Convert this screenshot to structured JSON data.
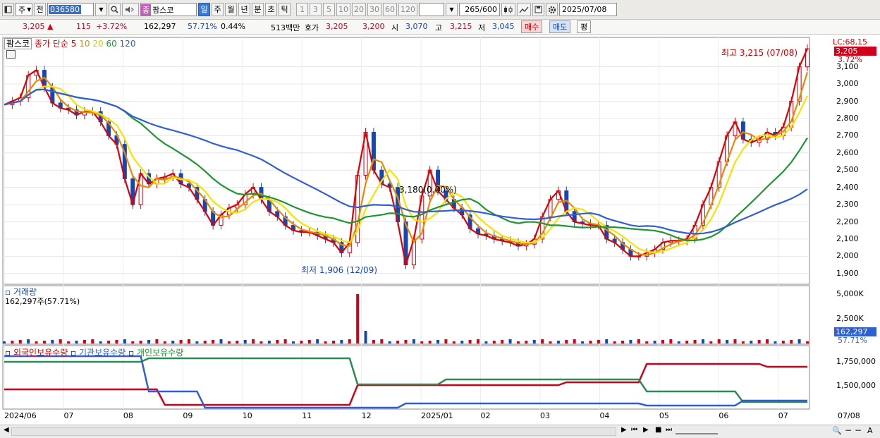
{
  "toolbar": {
    "market": "주",
    "prev_label": "전",
    "code": "036580",
    "name_icon": "종",
    "name": "팜스코",
    "periods": [
      "일",
      "주",
      "월",
      "년",
      "분",
      "초",
      "틱"
    ],
    "period_selected": "일",
    "counts": [
      "1",
      "3",
      "5",
      "10",
      "20",
      "30",
      "60",
      "120"
    ],
    "range": "265/600",
    "date": "2025/07/08"
  },
  "quote": {
    "price": "3,205 ▲",
    "change": "115",
    "rate": "+3.72%",
    "volume": "162,297",
    "vol_rate": "57.71%",
    "turnover": "0.44%",
    "amount": "513백만",
    "bid_label": "호가",
    "bid1": "3,205",
    "bid2": "3,200",
    "open_label": "시",
    "open": "3,070",
    "high_label": "고",
    "high": "3,215",
    "low_label": "저",
    "low": "3,045",
    "buy": "매수",
    "sell": "매도",
    "avg": "평"
  },
  "legend": {
    "stock_name": "팜스코",
    "ma_title": "종가 단순 5",
    "ma10": "10",
    "ma20": "20",
    "ma60": "60",
    "ma120": "120",
    "colors": {
      "ma5": "#e00000",
      "ma10": "#e88a00",
      "ma20": "#f5e300",
      "ma60": "#1e9632",
      "ma120": "#2f5fd0"
    }
  },
  "annotations": {
    "high": "최고 3,215 (07/08)",
    "low": "최저 1,906 (12/09)",
    "mid": "3,180(0.00%)"
  },
  "price_axis": {
    "lc": "LC:68,15",
    "last": "3,205",
    "rate": "3.72%",
    "ticks": [
      "3,100",
      "3,000",
      "2,900",
      "2,800",
      "2,700",
      "2,600",
      "2,500",
      "2,400",
      "2,300",
      "2,200",
      "2,100",
      "2,000",
      "1,900"
    ]
  },
  "volume_panel": {
    "title": "거래량",
    "value": "162,297주(57.71%)",
    "ticks": [
      "5,000K",
      "2,500K"
    ],
    "last": "162,297",
    "rate": "57.71%"
  },
  "holding_panel": {
    "l1": "외국인보유수량",
    "l2": "기관보유수량",
    "l3": "개인보유수량",
    "ticks": [
      "1,750,000",
      "1,500,000"
    ]
  },
  "x_axis": [
    "2024/06",
    "07",
    "08",
    "09",
    "10",
    "11",
    "12",
    "2025/01",
    "02",
    "03",
    "04",
    "05",
    "06",
    "07",
    "07/08"
  ],
  "chart_data": {
    "type": "line",
    "title": "팜스코 일봉",
    "y_range": [
      1850,
      3250
    ],
    "close": [
      2880,
      2900,
      2920,
      3050,
      3080,
      2980,
      2890,
      2860,
      2850,
      2820,
      2840,
      2840,
      2780,
      2700,
      2650,
      2450,
      2300,
      2480,
      2420,
      2450,
      2460,
      2480,
      2420,
      2400,
      2330,
      2260,
      2180,
      2240,
      2280,
      2300,
      2360,
      2400,
      2330,
      2260,
      2230,
      2180,
      2150,
      2140,
      2140,
      2120,
      2100,
      2080,
      2020,
      2080,
      2470,
      2720,
      2500,
      2420,
      2400,
      2200,
      1950,
      2100,
      2350,
      2500,
      2380,
      2330,
      2280,
      2240,
      2160,
      2130,
      2120,
      2100,
      2090,
      2080,
      2060,
      2070,
      2100,
      2230,
      2330,
      2380,
      2260,
      2200,
      2190,
      2180,
      2180,
      2100,
      2080,
      2040,
      2000,
      2000,
      2020,
      2040,
      2080,
      2090,
      2090,
      2100,
      2180,
      2300,
      2400,
      2550,
      2700,
      2780,
      2680,
      2660,
      2680,
      2720,
      2700,
      2750,
      2900,
      3100,
      3205
    ]
  }
}
